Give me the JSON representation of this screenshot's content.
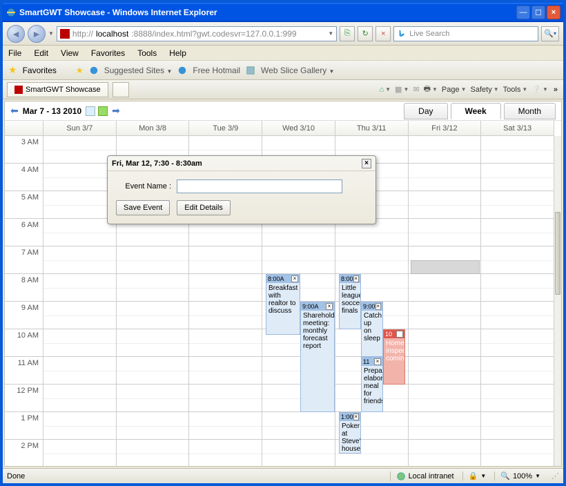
{
  "window": {
    "title": "SmartGWT Showcase - Windows Internet Explorer"
  },
  "address": {
    "host": "localhost",
    "port_path": ":8888/index.html?gwt.codesvr=127.0.0.1:999"
  },
  "menubar": {
    "file": "File",
    "edit": "Edit",
    "view": "View",
    "favorites": "Favorites",
    "tools": "Tools",
    "help": "Help"
  },
  "favbar": {
    "favorites": "Favorites",
    "suggested": "Suggested Sites",
    "hotmail": "Free Hotmail",
    "webslice": "Web Slice Gallery"
  },
  "tab": {
    "label": "SmartGWT Showcase"
  },
  "cmdbar": {
    "page": "Page",
    "safety": "Safety",
    "tools": "Tools"
  },
  "search": {
    "placeholder": "Live Search"
  },
  "calendar": {
    "range": "Mar 7 - 13 2010",
    "views": {
      "day": "Day",
      "week": "Week",
      "month": "Month"
    },
    "days": {
      "sun": "Sun 3/7",
      "mon": "Mon 3/8",
      "tue": "Tue 3/9",
      "wed": "Wed 3/10",
      "thu": "Thu 3/11",
      "fri": "Fri 3/12",
      "sat": "Sat 3/13"
    },
    "hours": [
      "3 AM",
      "4 AM",
      "5 AM",
      "6 AM",
      "7 AM",
      "8 AM",
      "9 AM",
      "10 AM",
      "11 AM",
      "12 PM",
      "1 PM",
      "2 PM"
    ]
  },
  "events": {
    "e1": {
      "time": "8:00A",
      "title": "Breakfast with realtor to discuss"
    },
    "e2": {
      "time": "9:00A",
      "title": "Shareholder meeting: monthly forecast report"
    },
    "e3": {
      "time": "8:00",
      "title": "Little league soccer finals"
    },
    "e4": {
      "time": "1:00",
      "title": "Poker at Steve's house"
    },
    "e5": {
      "time": "9:00",
      "title": "Catch up on sleep"
    },
    "e6": {
      "time": "11",
      "title": "Prepare elaborate meal for friends"
    },
    "e7": {
      "time": "10",
      "title": "Home inspector coming"
    }
  },
  "popup": {
    "title": "Fri, Mar 12, 7:30 - 8:30am",
    "label": "Event Name :",
    "save": "Save Event",
    "edit": "Edit Details"
  },
  "status": {
    "done": "Done",
    "zone": "Local intranet",
    "zoom": "100%"
  }
}
